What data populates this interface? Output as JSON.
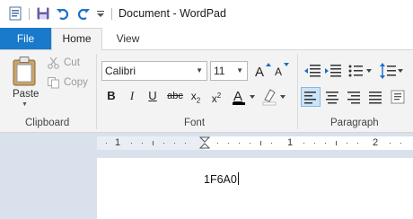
{
  "window": {
    "title": "Document - WordPad"
  },
  "quick_access": {
    "items": [
      {
        "name": "app-icon"
      },
      {
        "name": "save-icon"
      },
      {
        "name": "undo-icon"
      },
      {
        "name": "redo-icon"
      },
      {
        "name": "customize-dropdown-icon"
      }
    ]
  },
  "tabs": [
    {
      "label": "File",
      "active": false
    },
    {
      "label": "Home",
      "active": true
    },
    {
      "label": "View",
      "active": false
    }
  ],
  "clipboard": {
    "paste_label": "Paste",
    "cut_label": "Cut",
    "copy_label": "Copy",
    "group_label": "Clipboard"
  },
  "font": {
    "family": "Calibri",
    "size": "11",
    "group_label": "Font",
    "highlight_color": "#ffffff",
    "text_color": "#000000"
  },
  "paragraph": {
    "group_label": "Paragraph",
    "alignment": "left"
  },
  "ruler": {
    "labels": [
      "1",
      "1",
      "2"
    ]
  },
  "document": {
    "text": "1F6A0"
  },
  "colors": {
    "accent": "#1979ca",
    "ribbon_bg": "#f3f3f3",
    "workspace_bg": "#d8e1ec",
    "active_button": "#cce4f7"
  }
}
